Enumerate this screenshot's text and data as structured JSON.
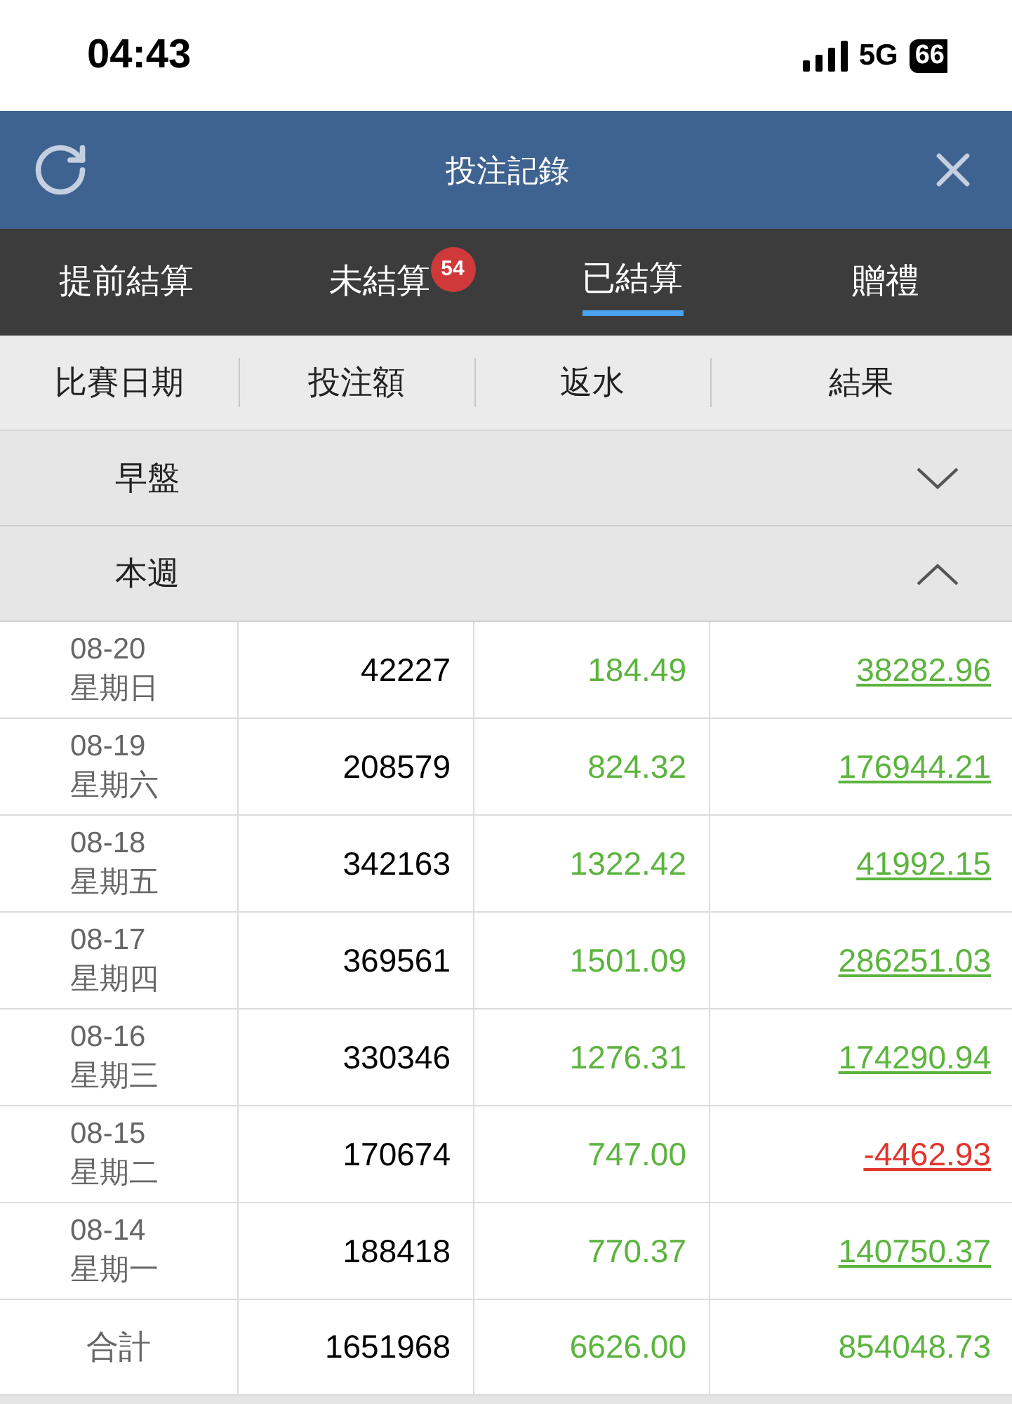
{
  "status_bar": {
    "time": "04:43",
    "network": "5G",
    "battery": "66"
  },
  "header": {
    "title": "投注記錄"
  },
  "tabs": [
    {
      "label": "提前結算",
      "selected": false
    },
    {
      "label": "未結算",
      "selected": false,
      "badge": "54"
    },
    {
      "label": "已結算",
      "selected": true
    },
    {
      "label": "贈禮",
      "selected": false
    }
  ],
  "table": {
    "columns": [
      "比賽日期",
      "投注額",
      "返水",
      "結果"
    ],
    "sections": [
      {
        "label": "早盤",
        "expanded": false
      },
      {
        "label": "本週",
        "expanded": true
      }
    ],
    "rows": [
      {
        "date": "08-20",
        "weekday": "星期日",
        "stake": "42227",
        "rebate": "184.49",
        "result": "38282.96",
        "negative": false
      },
      {
        "date": "08-19",
        "weekday": "星期六",
        "stake": "208579",
        "rebate": "824.32",
        "result": "176944.21",
        "negative": false
      },
      {
        "date": "08-18",
        "weekday": "星期五",
        "stake": "342163",
        "rebate": "1322.42",
        "result": "41992.15",
        "negative": false
      },
      {
        "date": "08-17",
        "weekday": "星期四",
        "stake": "369561",
        "rebate": "1501.09",
        "result": "286251.03",
        "negative": false
      },
      {
        "date": "08-16",
        "weekday": "星期三",
        "stake": "330346",
        "rebate": "1276.31",
        "result": "174290.94",
        "negative": false
      },
      {
        "date": "08-15",
        "weekday": "星期二",
        "stake": "170674",
        "rebate": "747.00",
        "result": "-4462.93",
        "negative": true
      },
      {
        "date": "08-14",
        "weekday": "星期一",
        "stake": "188418",
        "rebate": "770.37",
        "result": "140750.37",
        "negative": false
      }
    ],
    "total": {
      "label": "合計",
      "stake": "1651968",
      "rebate": "6626.00",
      "result": "854048.73"
    }
  }
}
